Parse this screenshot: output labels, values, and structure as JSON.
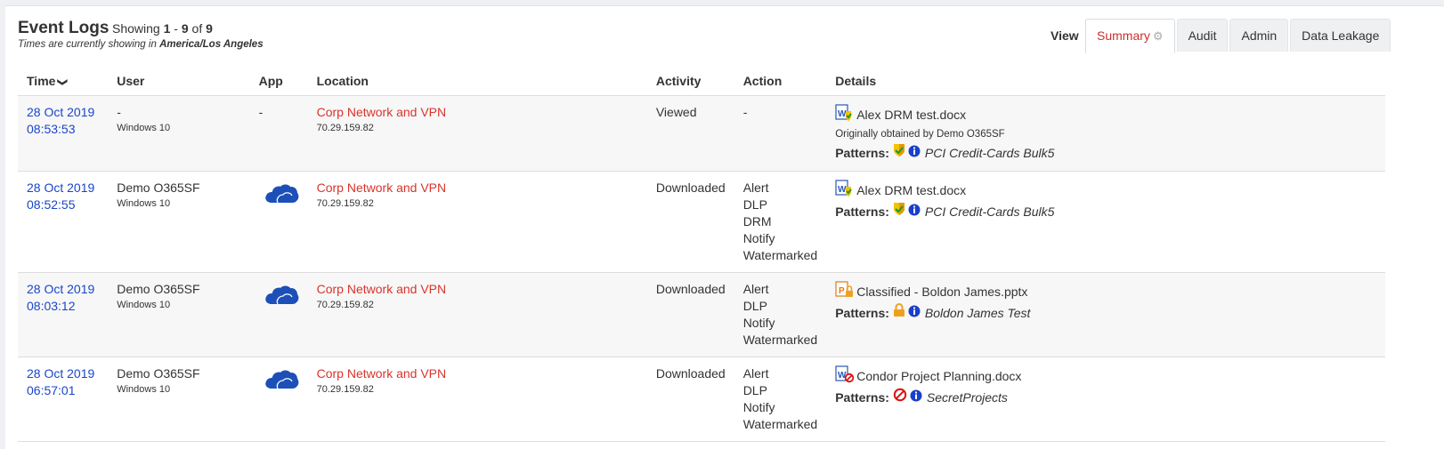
{
  "header": {
    "title": "Event Logs",
    "showing_prefix": "Showing",
    "range_start": "1",
    "range_sep": "-",
    "range_end": "9",
    "of_label": "of",
    "total": "9",
    "tz_prefix": "Times are currently showing in",
    "tz_value": "America/Los Angeles"
  },
  "view": {
    "label": "View",
    "tabs": [
      {
        "label": "Summary",
        "active": true
      },
      {
        "label": "Audit"
      },
      {
        "label": "Admin"
      },
      {
        "label": "Data Leakage"
      }
    ]
  },
  "columns": {
    "time": "Time",
    "user": "User",
    "app": "App",
    "location": "Location",
    "activity": "Activity",
    "action": "Action",
    "details": "Details"
  },
  "patterns_label": "Patterns:",
  "rows": [
    {
      "date": "28 Oct 2019",
      "time": "08:53:53",
      "user": "-",
      "os": "Windows 10",
      "app": "-",
      "app_icon": null,
      "location": "Corp Network and VPN",
      "ip": "70.29.159.82",
      "activity": "Viewed",
      "actions": [
        "-"
      ],
      "file_icon": "word-drm-icon",
      "file": "Alex DRM test.docx",
      "origin": "Originally obtained by Demo O365SF",
      "pattern_icon": "shield-icon",
      "pattern": "PCI Credit-Cards Bulk5"
    },
    {
      "date": "28 Oct 2019",
      "time": "08:52:55",
      "user": "Demo O365SF",
      "os": "Windows 10",
      "app": "",
      "app_icon": "onedrive-cloud-icon",
      "location": "Corp Network and VPN",
      "ip": "70.29.159.82",
      "activity": "Downloaded",
      "actions": [
        "Alert",
        "DLP",
        "DRM",
        "Notify",
        "Watermarked"
      ],
      "file_icon": "word-drm-icon",
      "file": "Alex DRM test.docx",
      "origin": "",
      "pattern_icon": "shield-icon",
      "pattern": "PCI Credit-Cards Bulk5"
    },
    {
      "date": "28 Oct 2019",
      "time": "08:03:12",
      "user": "Demo O365SF",
      "os": "Windows 10",
      "app": "",
      "app_icon": "onedrive-cloud-icon",
      "location": "Corp Network and VPN",
      "ip": "70.29.159.82",
      "activity": "Downloaded",
      "actions": [
        "Alert",
        "DLP",
        "Notify",
        "Watermarked"
      ],
      "file_icon": "powerpoint-lock-icon",
      "file": "Classified - Boldon James.pptx",
      "origin": "",
      "pattern_icon": "lock-icon",
      "pattern": "Boldon James Test"
    },
    {
      "date": "28 Oct 2019",
      "time": "06:57:01",
      "user": "Demo O365SF",
      "os": "Windows 10",
      "app": "",
      "app_icon": "onedrive-cloud-icon",
      "location": "Corp Network and VPN",
      "ip": "70.29.159.82",
      "activity": "Downloaded",
      "actions": [
        "Alert",
        "DLP",
        "Notify",
        "Watermarked"
      ],
      "file_icon": "word-blocked-icon",
      "file": "Condor Project Planning.docx",
      "origin": "",
      "pattern_icon": "no-entry-icon",
      "pattern": "SecretProjects"
    }
  ],
  "colors": {
    "date_link": "#1a46c8",
    "location": "#d9342b",
    "active_tab": "#c9302c",
    "cloud": "#1c4fb8",
    "info": "#1a3fcc"
  }
}
